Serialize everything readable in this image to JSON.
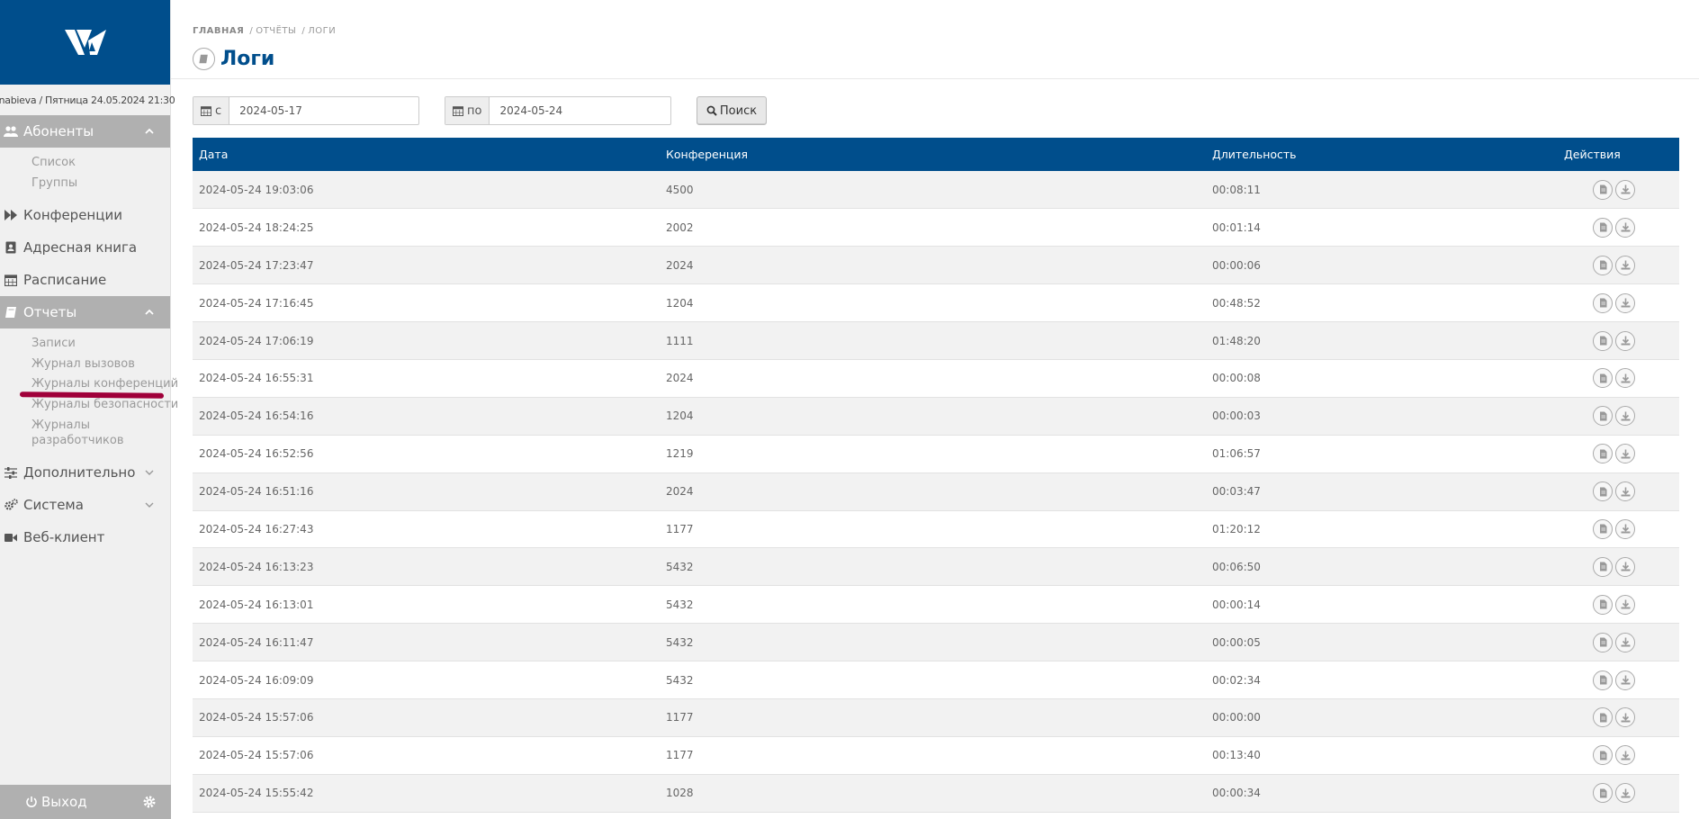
{
  "sidebar": {
    "user_info": "nabieva / Пятница 24.05.2024 21:30",
    "sections": {
      "subscribers": {
        "label": "Абоненты",
        "items": [
          "Список",
          "Группы"
        ]
      },
      "conferences": {
        "label": "Конференции"
      },
      "addressbook": {
        "label": "Адресная книга"
      },
      "schedule": {
        "label": "Расписание"
      },
      "reports": {
        "label": "Отчеты",
        "items": [
          "Записи",
          "Журнал вызовов",
          "Журналы конференций",
          "Журналы безопасности",
          "Журналы разработчиков"
        ]
      },
      "additional": {
        "label": "Дополнительно"
      },
      "system": {
        "label": "Система"
      },
      "webclient": {
        "label": "Веб-клиент"
      }
    },
    "logout_label": "Выход"
  },
  "breadcrumb": {
    "home": "ГЛАВНАЯ",
    "reports": "ОТЧЁТЫ",
    "logs": "ЛОГИ"
  },
  "page_title": "Логи",
  "filter": {
    "from_label": "с",
    "from_value": "2024-05-17",
    "to_label": "по",
    "to_value": "2024-05-24",
    "search_label": "Поиск"
  },
  "table": {
    "headers": {
      "date": "Дата",
      "conference": "Конференция",
      "duration": "Длительность",
      "actions": "Действия"
    },
    "rows": [
      {
        "date": "2024-05-24 19:03:06",
        "conference": "4500",
        "duration": "00:08:11"
      },
      {
        "date": "2024-05-24 18:24:25",
        "conference": "2002",
        "duration": "00:01:14"
      },
      {
        "date": "2024-05-24 17:23:47",
        "conference": "2024",
        "duration": "00:00:06"
      },
      {
        "date": "2024-05-24 17:16:45",
        "conference": "1204",
        "duration": "00:48:52"
      },
      {
        "date": "2024-05-24 17:06:19",
        "conference": "1111",
        "duration": "01:48:20"
      },
      {
        "date": "2024-05-24 16:55:31",
        "conference": "2024",
        "duration": "00:00:08"
      },
      {
        "date": "2024-05-24 16:54:16",
        "conference": "1204",
        "duration": "00:00:03"
      },
      {
        "date": "2024-05-24 16:52:56",
        "conference": "1219",
        "duration": "01:06:57"
      },
      {
        "date": "2024-05-24 16:51:16",
        "conference": "2024",
        "duration": "00:03:47"
      },
      {
        "date": "2024-05-24 16:27:43",
        "conference": "1177",
        "duration": "01:20:12"
      },
      {
        "date": "2024-05-24 16:13:23",
        "conference": "5432",
        "duration": "00:06:50"
      },
      {
        "date": "2024-05-24 16:13:01",
        "conference": "5432",
        "duration": "00:00:14"
      },
      {
        "date": "2024-05-24 16:11:47",
        "conference": "5432",
        "duration": "00:00:05"
      },
      {
        "date": "2024-05-24 16:09:09",
        "conference": "5432",
        "duration": "00:02:34"
      },
      {
        "date": "2024-05-24 15:57:06",
        "conference": "1177",
        "duration": "00:00:00"
      },
      {
        "date": "2024-05-24 15:57:06",
        "conference": "1177",
        "duration": "00:13:40"
      },
      {
        "date": "2024-05-24 15:55:42",
        "conference": "1028",
        "duration": "00:00:34"
      }
    ]
  },
  "colors": {
    "brand": "#004e8c",
    "sidebar_active": "#b0b0b0",
    "underline_mark": "#a0003a"
  },
  "icons": {
    "row_actions": [
      "document-icon",
      "download-icon"
    ],
    "filter": [
      "calendar-icon",
      "calendar-icon",
      "search-icon"
    ]
  }
}
